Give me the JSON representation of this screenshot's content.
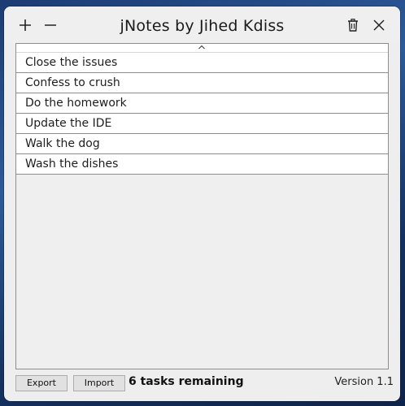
{
  "app": {
    "title": "jNotes by Jihed Kdiss"
  },
  "titlebar": {
    "add_icon": "plus-icon",
    "remove_icon": "minus-icon",
    "delete_icon": "trash-icon",
    "close_icon": "close-icon"
  },
  "list": {
    "sort_indicator": "chevron-up-icon",
    "items": [
      {
        "label": "Close the issues"
      },
      {
        "label": "Confess to crush"
      },
      {
        "label": "Do the homework"
      },
      {
        "label": "Update the IDE"
      },
      {
        "label": "Walk the dog"
      },
      {
        "label": "Wash the dishes"
      }
    ]
  },
  "footer": {
    "export_label": "Export",
    "import_label": "Import",
    "remaining_text": "6 tasks remaining",
    "version_text": "Version 1.1"
  }
}
